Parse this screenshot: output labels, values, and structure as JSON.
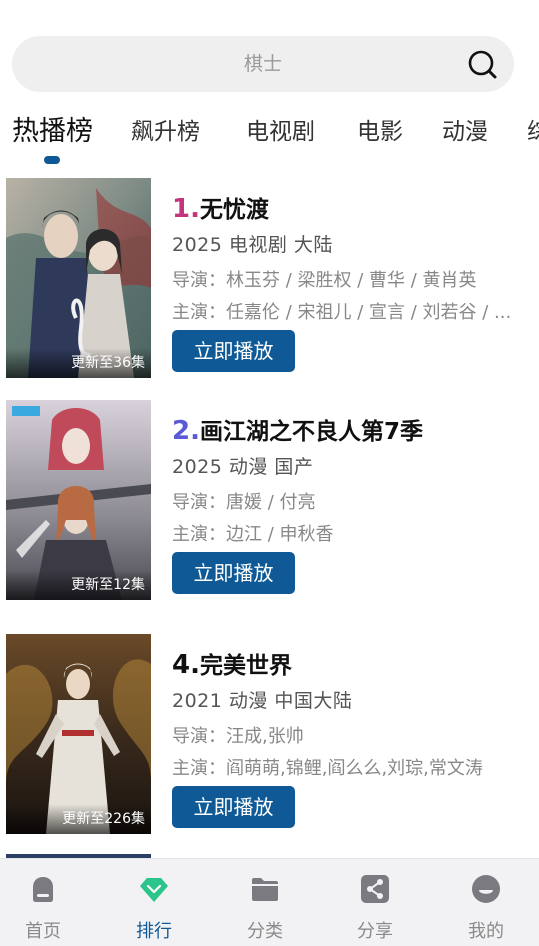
{
  "search": {
    "placeholder": "棋士"
  },
  "tabs": [
    {
      "label": "热播榜",
      "active": true
    },
    {
      "label": "飙升榜"
    },
    {
      "label": "电视剧"
    },
    {
      "label": "电影"
    },
    {
      "label": "动漫"
    },
    {
      "label": "综"
    }
  ],
  "items": [
    {
      "rank": "1.",
      "rank_color": "#c2357a",
      "title": "无忧渡",
      "meta": "2025  电视剧  大陆",
      "director": "导演：林玉芬 / 梁胜权 / 曹华 / 黄肖英",
      "cast": "主演：任嘉伦 / 宋祖儿 / 宣言 / 刘若谷 / ...",
      "update": "更新至36集",
      "play_label": "立即播放"
    },
    {
      "rank": "2.",
      "rank_color": "#5a5ad6",
      "title": "画江湖之不良人第7季",
      "meta": "2025  动漫  国产",
      "director": "导演：唐媛 / 付亮",
      "cast": "主演：边江 / 申秋香",
      "update": "更新至12集",
      "play_label": "立即播放"
    },
    {
      "rank": "4.",
      "rank_color": "#111111",
      "title": "完美世界",
      "meta": "2021  动漫  中国大陆",
      "director": "导演：汪成,张帅",
      "cast": "主演：阎萌萌,锦鲤,阎么么,刘琮,常文涛",
      "update": "更新至226集",
      "play_label": "立即播放"
    }
  ],
  "nav": [
    {
      "label": "首页",
      "icon": "home-icon"
    },
    {
      "label": "排行",
      "icon": "diamond-icon",
      "active": true
    },
    {
      "label": "分类",
      "icon": "folder-icon"
    },
    {
      "label": "分享",
      "icon": "share-icon"
    },
    {
      "label": "我的",
      "icon": "profile-icon"
    }
  ],
  "colors": {
    "accent": "#0f5a96",
    "nav_active": "#2bc48a"
  }
}
